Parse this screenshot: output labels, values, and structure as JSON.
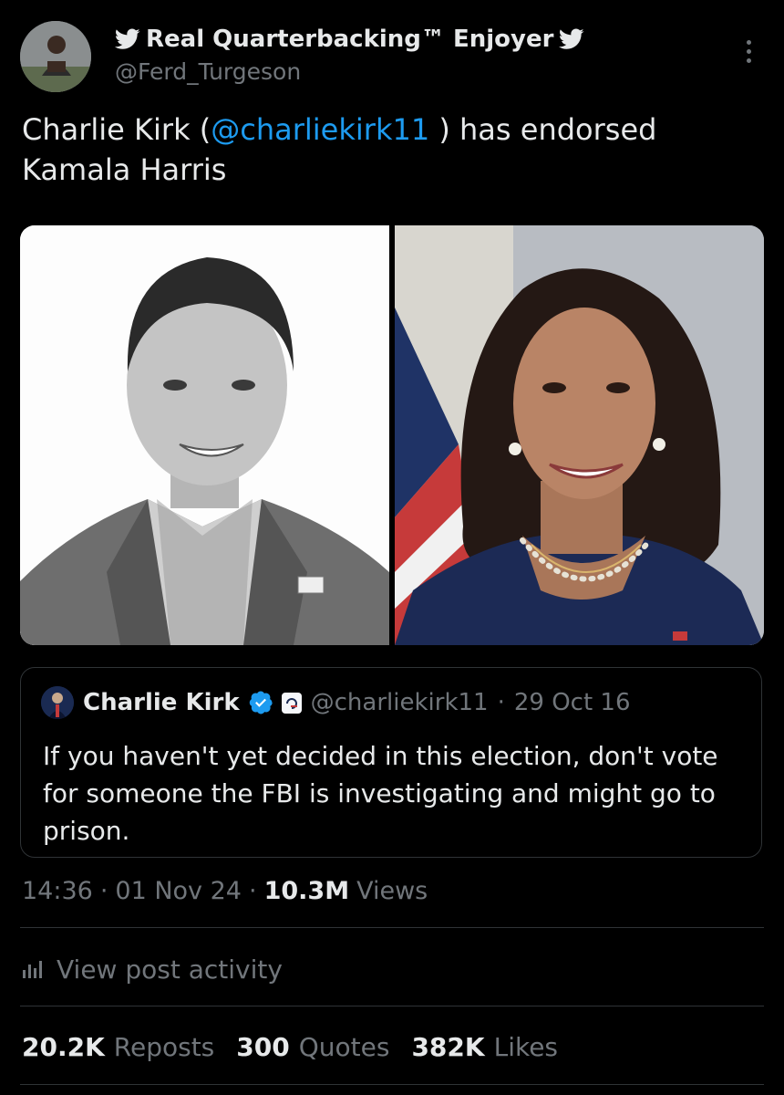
{
  "author": {
    "display_name": "Real Quarterbacking™ Enjoyer",
    "handle": "@Ferd_Turgeson",
    "avatar": "profile-photo"
  },
  "tweet": {
    "text_before": "Charlie Kirk (",
    "mention": "@charliekirk11",
    "text_line1_after": " ) has endorsed",
    "text_line2": "Kamala Harris",
    "media": [
      {
        "name": "photo-charlie-kirk",
        "description_icon": "portrait-photo"
      },
      {
        "name": "photo-kamala-harris",
        "description_icon": "portrait-photo"
      }
    ]
  },
  "quote": {
    "name": "Charlie Kirk",
    "handle": "@charliekirk11",
    "separator": "·",
    "date": "29 Oct 16",
    "text_line1": "If you haven't yet decided in this election, don't vote",
    "text_line2": "for someone the FBI is investigating and might go to",
    "text_line3": "prison."
  },
  "meta": {
    "time": "14:36",
    "sep1": "·",
    "date": "01 Nov 24",
    "sep2": "·",
    "views_count": "10.3M",
    "views_label": "Views"
  },
  "activity": {
    "label": "View post activity",
    "icon": "analytics-icon"
  },
  "stats": {
    "reposts_count": "20.2K",
    "reposts_label": "Reposts",
    "quotes_count": "300",
    "quotes_label": "Quotes",
    "likes_count": "382K",
    "likes_label": "Likes"
  },
  "colors": {
    "background": "#000000",
    "text_primary": "#e7e9ea",
    "text_secondary": "#71767b",
    "accent": "#1d9bf0",
    "border": "#2f3336"
  }
}
